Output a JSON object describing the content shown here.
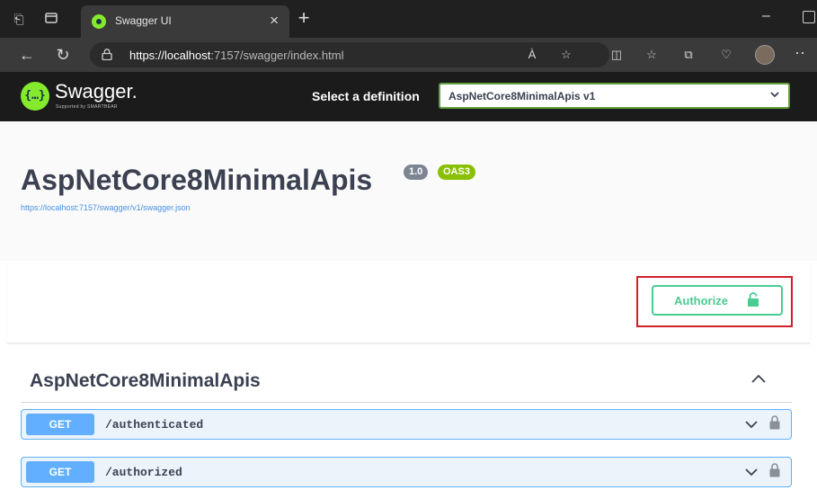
{
  "browser": {
    "tab_title": "Swagger UI",
    "tab_close": "×",
    "new_tab": "+",
    "minimize": "–",
    "url_host": "https://localhost",
    "url_rest": ":7157/swagger/index.html",
    "read_aloud": "À",
    "more": "··"
  },
  "header": {
    "logo_word": "Swagger.",
    "logo_sub": "Supported by SMARTBEAR",
    "logo_mark": "{…}",
    "select_label": "Select a definition",
    "select_value": "AspNetCore8MinimalApis v1"
  },
  "info": {
    "title": "AspNetCore8MinimalApis",
    "version_badge": "1.0",
    "oas_badge": "OAS3",
    "spec_url": "https://localhost:7157/swagger/v1/swagger.json"
  },
  "auth": {
    "button_label": "Authorize"
  },
  "tag": {
    "title": "AspNetCore8MinimalApis",
    "operations": [
      {
        "method": "GET",
        "path": "/authenticated"
      },
      {
        "method": "GET",
        "path": "/authorized"
      }
    ]
  },
  "colors": {
    "swagger_green": "#85ea2d",
    "authorize_green": "#49cc90",
    "get_blue": "#61affe",
    "highlight_red": "#d21f2a",
    "oas_green": "#89bf04"
  },
  "icons": [
    "tab-actions-icon",
    "tab-strip-icon",
    "back-arrow-icon",
    "refresh-icon",
    "lock-icon",
    "read-aloud-icon",
    "favorite-star-icon",
    "split-screen-icon",
    "favorites-icon",
    "collections-icon",
    "browser-essentials-icon",
    "profile-avatar",
    "chevron-down-icon",
    "chevron-up-icon",
    "padlock-icon"
  ]
}
